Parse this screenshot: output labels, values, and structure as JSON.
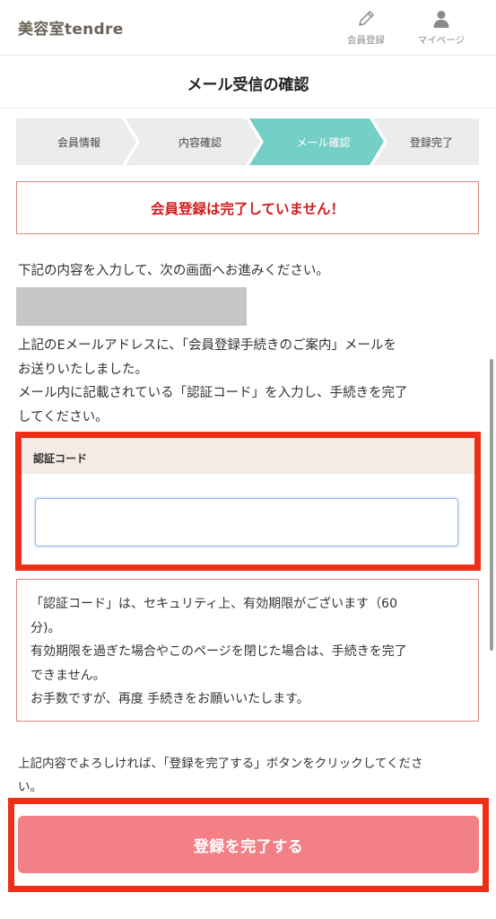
{
  "header": {
    "logo": "美容室tendre",
    "nav": [
      {
        "label": "会員登録",
        "icon": "pencil-icon"
      },
      {
        "label": "マイページ",
        "icon": "user-icon"
      }
    ]
  },
  "page_title": "メール受信の確認",
  "steps": [
    {
      "label": "会員情報",
      "active": false
    },
    {
      "label": "内容確認",
      "active": false
    },
    {
      "label": "メール確認",
      "active": true
    },
    {
      "label": "登録完了",
      "active": false
    }
  ],
  "colors": {
    "step_active": "#74cfc6",
    "step_inactive": "#ececec",
    "warning": "#d21b1b",
    "highlight_frame": "#ee2f17",
    "submit_button": "#f28086"
  },
  "warning": "会員登録は完了していません！",
  "intro": "下記の内容を入力して、次の画面へお進みください。",
  "description": [
    "上記のEメールアドレスに、「会員登録手続きのご案内」メールを",
    "お送りいたしました。",
    "メール内に記載されている「認証コード」を入力し、手続きを完了",
    "してください。"
  ],
  "code_field": {
    "label": "認証コード",
    "value": ""
  },
  "notice": [
    "「認証コード」は、セキュリティ上、有効期限がございます（60",
    "分)。",
    "有効期限を過ぎた場合やこのページを閉じた場合は、手続きを完了",
    "できません。",
    "お手数ですが、再度 手続きをお願いいたします。"
  ],
  "confirm": [
    "上記内容でよろしければ、「登録を完了する」ボタンをクリックしてくださ",
    "い。"
  ],
  "submit_label": "登録を完了する"
}
